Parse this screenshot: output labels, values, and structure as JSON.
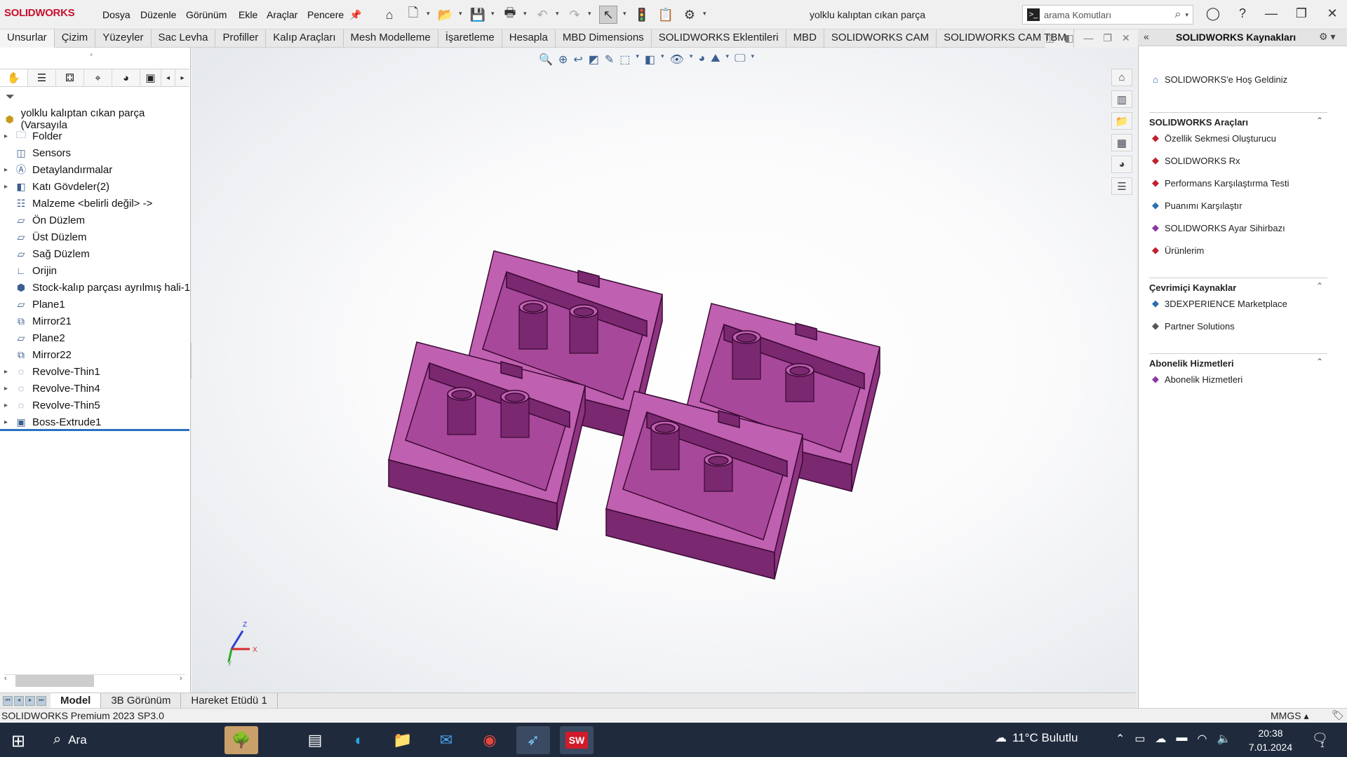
{
  "app": {
    "logo": "SOLIDWORKS",
    "document_title": "yolklu kalıptan cıkan parça"
  },
  "menu": [
    "Dosya",
    "Düzenle",
    "Görünüm",
    "Ekle",
    "Araçlar",
    "Pencere"
  ],
  "search": {
    "placeholder": "arama Komutları"
  },
  "command_tabs": [
    "Unsurlar",
    "Çizim",
    "Yüzeyler",
    "Sac Levha",
    "Profiller",
    "Kalıp Araçları",
    "Mesh Modelleme",
    "İşaretleme",
    "Hesapla",
    "MBD Dimensions",
    "SOLIDWORKS Eklentileri",
    "MBD",
    "SOLIDWORKS CAM",
    "SOLIDWORKS CAM TBM"
  ],
  "feature_tree": {
    "root": "yolklu kalıptan cıkan parça  (Varsayıla",
    "items": [
      {
        "label": "Folder",
        "expand": "▸",
        "icon": "folder-icon"
      },
      {
        "label": "Sensors",
        "expand": "",
        "icon": "sensors-icon"
      },
      {
        "label": "Detaylandırmalar",
        "expand": "▸",
        "icon": "annotations-icon"
      },
      {
        "label": "Katı Gövdeler(2)",
        "expand": "▸",
        "icon": "solid-bodies-icon"
      },
      {
        "label": "Malzeme <belirli değil> ->",
        "expand": "",
        "icon": "material-icon"
      },
      {
        "label": "Ön Düzlem",
        "expand": "",
        "icon": "plane-icon"
      },
      {
        "label": "Üst Düzlem",
        "expand": "",
        "icon": "plane-icon"
      },
      {
        "label": "Sağ Düzlem",
        "expand": "",
        "icon": "plane-icon"
      },
      {
        "label": "Orijin",
        "expand": "",
        "icon": "origin-icon"
      },
      {
        "label": "Stock-kalıp parçası ayrılmış hali-1",
        "expand": "",
        "icon": "stock-part-icon"
      },
      {
        "label": "Plane1",
        "expand": "",
        "icon": "plane-icon"
      },
      {
        "label": "Mirror21",
        "expand": "",
        "icon": "mirror-icon"
      },
      {
        "label": "Plane2",
        "expand": "",
        "icon": "plane-icon"
      },
      {
        "label": "Mirror22",
        "expand": "",
        "icon": "mirror-icon"
      },
      {
        "label": "Revolve-Thin1",
        "expand": "▸",
        "icon": "revolve-icon"
      },
      {
        "label": "Revolve-Thin4",
        "expand": "▸",
        "icon": "revolve-icon"
      },
      {
        "label": "Revolve-Thin5",
        "expand": "▸",
        "icon": "revolve-icon"
      },
      {
        "label": "Boss-Extrude1",
        "expand": "▸",
        "icon": "extrude-icon"
      }
    ]
  },
  "bottom_tabs": [
    "Model",
    "3B Görünüm",
    "Hareket Etüdü 1"
  ],
  "status": {
    "version": "SOLIDWORKS Premium 2023 SP3.0",
    "units": "MMGS"
  },
  "model": {
    "part_color": "#c060b0",
    "part_shadow": "#7a2870",
    "part_edge": "#3a0a35"
  },
  "task_pane": {
    "title": "SOLIDWORKS Kaynakları",
    "welcome": "SOLIDWORKS'e Hoş Geldiniz",
    "sections": [
      {
        "title": "SOLIDWORKS Araçları",
        "items": [
          "Özellik Sekmesi Oluşturucu",
          "SOLIDWORKS Rx",
          "Performans Karşılaştırma Testi",
          "Puanımı Karşılaştır",
          "SOLIDWORKS Ayar Sihirbazı",
          "Ürünlerim"
        ]
      },
      {
        "title": "Çevrimiçi Kaynaklar",
        "items": [
          "3DEXPERIENCE Marketplace",
          "Partner Solutions"
        ]
      },
      {
        "title": "Abonelik Hizmetleri",
        "items": [
          "Abonelik Hizmetleri"
        ]
      }
    ]
  },
  "triad": {
    "x": "X",
    "y": "Y",
    "z": "Z"
  },
  "taskbar": {
    "search": "Ara",
    "weather": "11°C  Bulutlu",
    "time": "20:38",
    "date": "7.01.2024",
    "notification_count": "1"
  }
}
